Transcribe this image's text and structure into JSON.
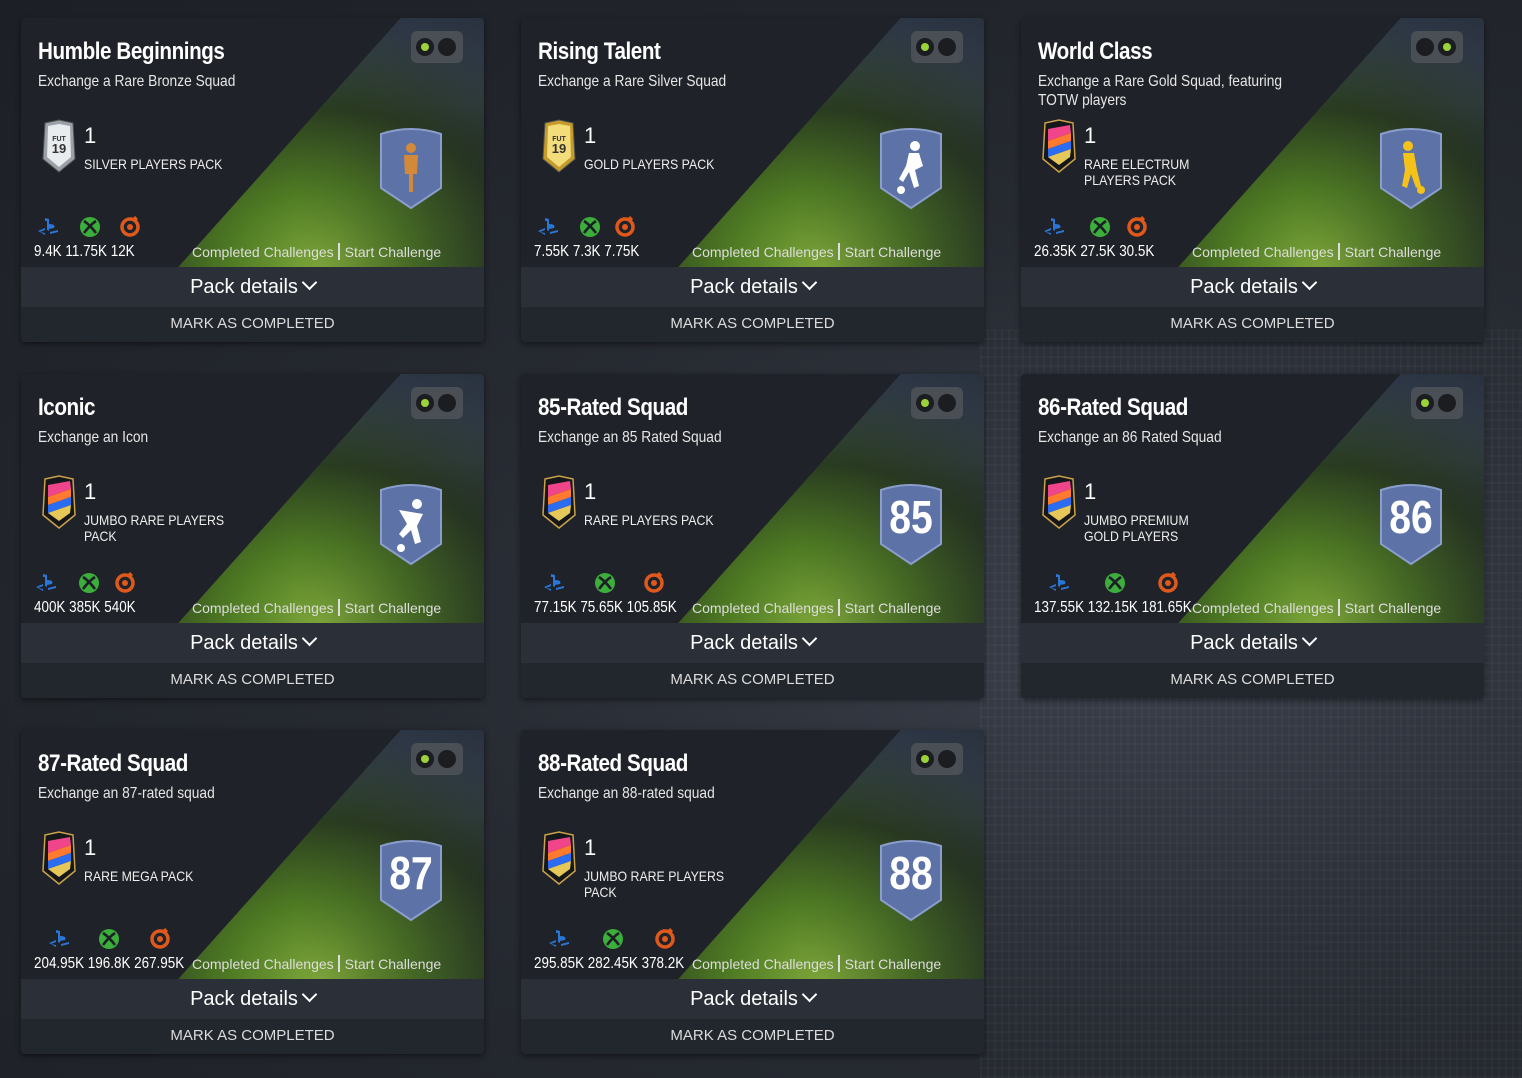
{
  "cards": [
    {
      "title": "Humble Beginnings",
      "subtitle": "Exchange a Rare Bronze Squad",
      "pack_count": "1",
      "pack_name": "SILVER PLAYERS PACK",
      "pack_icon": "fut19-silver-pack-icon",
      "badge": "bronze-player-figure-icon",
      "badge_text": "",
      "prices": "9.4K 11.75K 12K",
      "toggle": "left"
    },
    {
      "title": "Rising Talent",
      "subtitle": "Exchange a Rare Silver Squad",
      "pack_count": "1",
      "pack_name": "GOLD PLAYERS PACK",
      "pack_icon": "fut19-gold-pack-icon",
      "badge": "silver-player-figure-icon",
      "badge_text": "",
      "prices": "7.55K 7.3K 7.75K",
      "toggle": "left"
    },
    {
      "title": "World Class",
      "subtitle": "Exchange a Rare Gold Squad, featuring TOTW players",
      "pack_count": "1",
      "pack_name": "RARE ELECTRUM PLAYERS PACK",
      "pack_icon": "rare-pack-icon",
      "badge": "gold-player-figure-icon",
      "badge_text": "",
      "prices": "26.35K 27.5K 30.5K",
      "toggle": "right"
    },
    {
      "title": "Iconic",
      "subtitle": "Exchange an Icon",
      "pack_count": "1",
      "pack_name": "JUMBO RARE PLAYERS PACK",
      "pack_icon": "rare-pack-icon",
      "badge": "icon-player-figure-icon",
      "badge_text": "",
      "prices": "400K 385K 540K",
      "toggle": "left"
    },
    {
      "title": "85-Rated Squad",
      "subtitle": "Exchange an 85 Rated Squad",
      "pack_count": "1",
      "pack_name": "RARE PLAYERS PACK",
      "pack_icon": "rare-pack-icon",
      "badge": "rating-badge",
      "badge_text": "85",
      "prices": "77.15K 75.65K 105.85K",
      "toggle": "left"
    },
    {
      "title": "86-Rated Squad",
      "subtitle": "Exchange an 86 Rated Squad",
      "pack_count": "1",
      "pack_name": "JUMBO PREMIUM GOLD PLAYERS",
      "pack_icon": "rare-pack-icon",
      "badge": "rating-badge",
      "badge_text": "86",
      "prices": "137.55K 132.15K 181.65K",
      "toggle": "left"
    },
    {
      "title": "87-Rated Squad",
      "subtitle": "Exchange an 87-rated squad",
      "pack_count": "1",
      "pack_name": "RARE MEGA PACK",
      "pack_icon": "rare-pack-icon",
      "badge": "rating-badge",
      "badge_text": "87",
      "prices": "204.95K 196.8K 267.95K",
      "toggle": "left"
    },
    {
      "title": "88-Rated Squad",
      "subtitle": "Exchange an 88-rated squad",
      "pack_count": "1",
      "pack_name": "JUMBO RARE PLAYERS PACK",
      "pack_icon": "rare-pack-icon",
      "badge": "rating-badge",
      "badge_text": "88",
      "prices": "295.85K 282.45K 378.2K",
      "toggle": "left"
    }
  ],
  "labels": {
    "completed_challenges": "Completed Challenges",
    "start_challenge": "Start Challenge",
    "pack_details": "Pack details",
    "mark_completed": "MARK AS COMPLETED"
  },
  "platforms": [
    "playstation-icon",
    "xbox-icon",
    "pc-origin-icon"
  ],
  "colors": {
    "accent_green": "#9bd23a",
    "badge_blue": "#5a6fa3",
    "ps": "#1f6fd1",
    "xbox": "#3aa83a",
    "origin": "#e05a1e"
  }
}
